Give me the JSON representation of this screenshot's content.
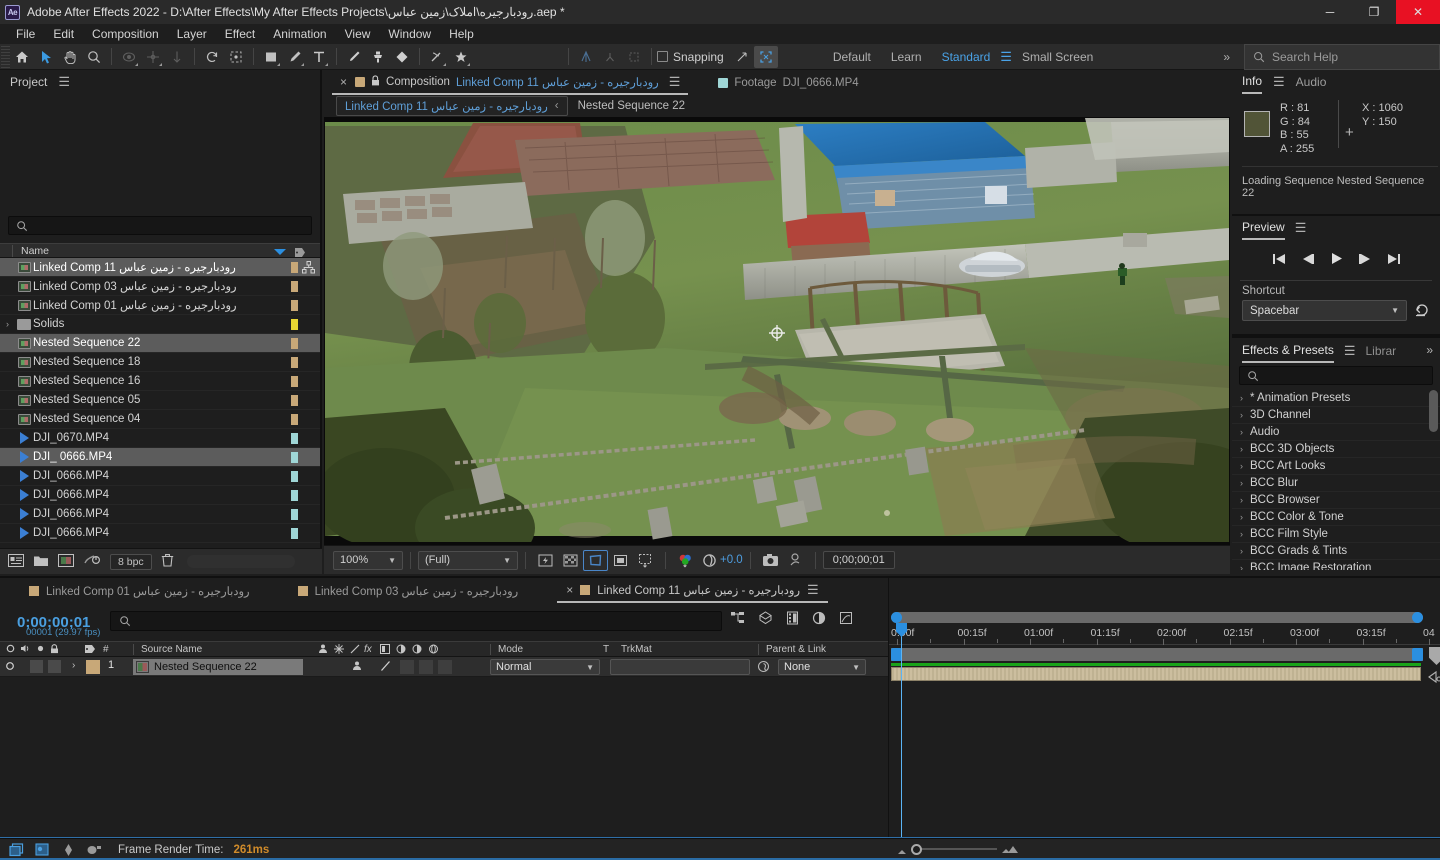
{
  "window": {
    "title": "Adobe After Effects 2022 - D:\\After Effects\\My After Effects Projects\\رودبارجیره\\املاک\\زمین عباس.aep *",
    "logo": "Ae",
    "minimize": "─",
    "maximize": "❐",
    "close": "✕"
  },
  "menu": [
    "File",
    "Edit",
    "Composition",
    "Layer",
    "Effect",
    "Animation",
    "View",
    "Window",
    "Help"
  ],
  "toolbar": {
    "icons": [
      "home-icon",
      "selection-tool-icon",
      "hand-tool-icon",
      "zoom-tool-icon",
      "orbit-tool-icon",
      "pan-tool-icon",
      "dolly-tool-icon",
      "rotation-tool-icon",
      "anchor-point-tool-icon",
      "shape-tool-icon",
      "pen-tool-icon",
      "type-tool-icon",
      "brush-tool-icon",
      "clone-stamp-tool-icon",
      "eraser-tool-icon",
      "roto-brush-tool-icon",
      "puppet-pin-tool-icon"
    ],
    "snapping_label": "Snapping",
    "workspaces": [
      "Default",
      "Learn",
      "Standard",
      "Small Screen"
    ],
    "active_workspace": "Standard",
    "overflow": "»"
  },
  "search_help": {
    "placeholder": "Search Help",
    "icon": "search-icon"
  },
  "project": {
    "tab": "Project",
    "menu_icon": "panel-menu-icon",
    "search_placeholder": "",
    "column_header": "Name",
    "items": [
      {
        "name": "رودبارجیره - زمین عباس Linked Comp 11",
        "type": "comp",
        "selected": true,
        "color": "#c8a878",
        "linked": true
      },
      {
        "name": "رودبارجیره - زمین عباس Linked Comp 03",
        "type": "comp",
        "selected": false,
        "color": "#c8a878"
      },
      {
        "name": "رودبارجیره - زمین عباس Linked Comp 01",
        "type": "comp",
        "selected": false,
        "color": "#c8a878"
      },
      {
        "name": "Solids",
        "type": "folder",
        "selected": false,
        "color": "#e8d632"
      },
      {
        "name": "Nested Sequence 22",
        "type": "comp",
        "selected": true,
        "color": "#c8a878"
      },
      {
        "name": "Nested Sequence 18",
        "type": "comp",
        "selected": false,
        "color": "#c8a878"
      },
      {
        "name": "Nested Sequence 16",
        "type": "comp",
        "selected": false,
        "color": "#c8a878"
      },
      {
        "name": "Nested Sequence 05",
        "type": "comp",
        "selected": false,
        "color": "#c8a878"
      },
      {
        "name": "Nested Sequence 04",
        "type": "comp",
        "selected": false,
        "color": "#c8a878"
      },
      {
        "name": "DJI_0670.MP4",
        "type": "video",
        "selected": false,
        "color": "#9fd6d6"
      },
      {
        "name": "DJI_ 0666.MP4",
        "type": "video",
        "selected": true,
        "color": "#9fd6d6"
      },
      {
        "name": "DJI_0666.MP4",
        "type": "video",
        "selected": false,
        "color": "#9fd6d6"
      },
      {
        "name": "DJI_0666.MP4",
        "type": "video",
        "selected": false,
        "color": "#9fd6d6"
      },
      {
        "name": "DJI_0666.MP4",
        "type": "video",
        "selected": false,
        "color": "#9fd6d6"
      },
      {
        "name": "DJI_0666.MP4",
        "type": "video",
        "selected": false,
        "color": "#9fd6d6"
      }
    ],
    "footer": {
      "bit_depth": "8 bpc"
    }
  },
  "composition": {
    "tabs": [
      {
        "prefix": "Composition",
        "name": "رودبارجیره - زمین عباس Linked Comp 11",
        "active": true,
        "swatch": "#c8a878"
      },
      {
        "prefix": "Footage",
        "name": "DJI_0666.MP4",
        "active": false,
        "swatch": "#9fd6d6"
      }
    ],
    "breadcrumb_active": "رودبارجیره - زمین عباس Linked Comp 11",
    "breadcrumb_chevron": "‹",
    "breadcrumb_next": "Nested Sequence 22",
    "bottom_bar": {
      "magnification": "100%",
      "resolution": "(Full)",
      "exposure": "+0.0",
      "timecode": "0;00;00;01",
      "tools": [
        "fast-previews-icon",
        "transparency-grid-icon",
        "region-of-interest-icon",
        "mask-guides-icon",
        "proportional-grid-icon",
        "channels-icon",
        "exposure-icon",
        "take-snapshot-icon",
        "show-snapshot-icon"
      ]
    }
  },
  "info": {
    "tabs": [
      "Info",
      "Audio"
    ],
    "active_tab": "Info",
    "swatch_color": "#515437",
    "channels": [
      {
        "label": "R :",
        "value": "81"
      },
      {
        "label": "G :",
        "value": "84"
      },
      {
        "label": "B :",
        "value": "55"
      },
      {
        "label": "A :",
        "value": "255"
      }
    ],
    "coords": [
      {
        "label": "X :",
        "value": "1060"
      },
      {
        "label": "Y :",
        "value": "150"
      }
    ],
    "status": "Loading Sequence Nested Sequence 22"
  },
  "preview": {
    "tab": "Preview",
    "transport": [
      "first-frame-icon",
      "previous-frame-icon",
      "play-icon",
      "next-frame-icon",
      "last-frame-icon"
    ],
    "shortcut_label": "Shortcut",
    "shortcut_value": "Spacebar",
    "reset_icon": "reset-icon"
  },
  "effects": {
    "tabs": [
      {
        "label": "Effects & Presets",
        "active": true
      },
      {
        "label": "Librar",
        "active": false
      }
    ],
    "overflow": "»",
    "search_placeholder": "",
    "categories": [
      "* Animation Presets",
      "3D Channel",
      "Audio",
      "BCC 3D Objects",
      "BCC Art Looks",
      "BCC Blur",
      "BCC Browser",
      "BCC Color & Tone",
      "BCC Film Style",
      "BCC Grads & Tints",
      "BCC Image Restoration"
    ]
  },
  "timeline": {
    "tabs": [
      {
        "name": "رودبارجیره - زمین عباس Linked Comp 01",
        "active": false,
        "swatch": "#c8a878"
      },
      {
        "name": "رودبارجیره - زمین عباس Linked Comp 03",
        "active": false,
        "swatch": "#c8a878"
      },
      {
        "name": "رودبارجیره - زمین عباس Linked Comp 11",
        "active": true,
        "swatch": "#c8a878"
      }
    ],
    "current_time": "0;00;00;01",
    "frame_info": "00001 (29.97 fps)",
    "search_placeholder": "",
    "columns": [
      "Source Name",
      "Mode",
      "T",
      "TrkMat",
      "Parent & Link"
    ],
    "layers": [
      {
        "index": "1",
        "name": "Nested Sequence 22",
        "mode": "Normal",
        "parent": "None",
        "trkmat": ""
      }
    ],
    "ruler_ticks": [
      "0:00f",
      "00:15f",
      "01:00f",
      "01:15f",
      "02:00f",
      "02:15f",
      "03:00f",
      "03:15f",
      "04"
    ]
  },
  "statusbar": {
    "icons": [
      "render-queue-icon",
      "composition-icon",
      "graph-editor-icon",
      "motion-blur-icon"
    ],
    "label": "Frame Render Time:",
    "value": "261ms"
  }
}
